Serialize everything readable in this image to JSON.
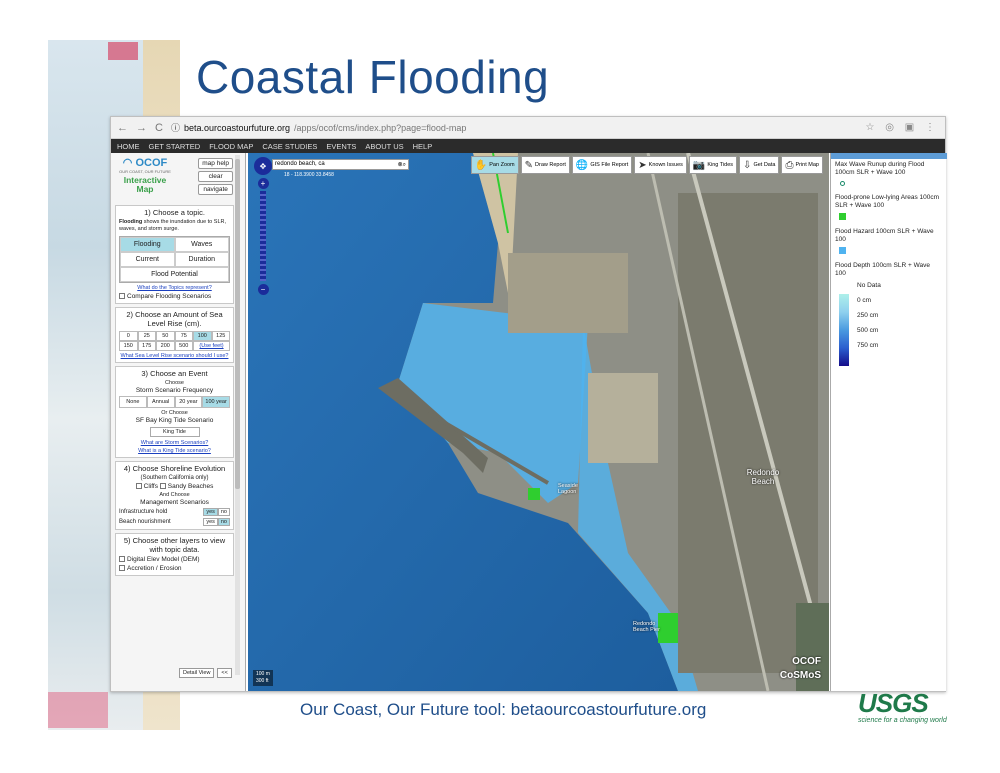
{
  "slide": {
    "title": "Coastal Flooding",
    "caption": "Our Coast, Our Future tool: betaourcoastourfuture.org",
    "usgs": {
      "mark": "USGS",
      "tagline": "science for a changing world"
    }
  },
  "browser": {
    "url_host": "beta.ourcoastourfuture.org",
    "url_path": "/apps/ocof/cms/index.php?page=flood-map"
  },
  "nav": [
    "HOME",
    "GET STARTED",
    "FLOOD MAP",
    "CASE STUDIES",
    "EVENTS",
    "ABOUT US",
    "HELP"
  ],
  "panel": {
    "logo_brand": "OCOF",
    "logo_sub": "OUR COAST, OUR FUTURE",
    "logo_title": "Interactive Map",
    "buttons": [
      "map help",
      "clear",
      "navigate"
    ],
    "sec1": {
      "title": "1) Choose a topic.",
      "desc_bold": "Flooding",
      "desc": " shows the inundation due to SLR, waves, and storm surge.",
      "topics": [
        "Flooding",
        "Waves",
        "Current",
        "Duration",
        "Flood Potential"
      ],
      "link": "What do the Topics represent?",
      "compare": "Compare Flooding Scenarios"
    },
    "sec2": {
      "title": "2) Choose an Amount of Sea Level Rise (cm).",
      "values": [
        "0",
        "25",
        "50",
        "75",
        "100",
        "125",
        "150",
        "175",
        "200",
        "500",
        "(Use feet)"
      ],
      "link": "What Sea Level Rise scenario should I use?"
    },
    "sec3": {
      "title": "3) Choose an Event",
      "choose": "Choose",
      "storm_label": "Storm Scenario Frequency",
      "storm": [
        "None",
        "Annual",
        "20 year",
        "100 year"
      ],
      "or_choose": "Or Choose",
      "king_label": "SF Bay King Tide Scenario",
      "king_btn": "King Tide",
      "link1": "What are Storm Scenarios?",
      "link2": "What is a King Tide scenario?"
    },
    "sec4": {
      "title": "4) Choose Shoreline Evolution",
      "sub": "(Southern California only)",
      "cliffs": "Cliffs",
      "beaches": "Sandy Beaches",
      "and_choose": "And Choose",
      "mgmt": "Management Scenarios",
      "infra": "Infrastructure hold",
      "nourish": "Beach nourishment",
      "yes": "yes",
      "no": "no"
    },
    "sec5": {
      "title": "5) Choose other layers to view with topic data.",
      "dem": "Digital Elev Model (DEM)",
      "accretion": "Accretion / Erosion"
    },
    "detail_view": "Detail View",
    "collapse": "<<"
  },
  "map": {
    "search_value": "redondo beach, ca",
    "coords": "18 - 118.3900 33.8458",
    "tools": [
      {
        "icon": "hand-icon",
        "glyph": "✋",
        "label": "Pan Zoom"
      },
      {
        "icon": "pencil-icon",
        "glyph": "✎",
        "label": "Draw Report"
      },
      {
        "icon": "globe-icon",
        "glyph": "🌐",
        "label": "GIS File Report"
      },
      {
        "icon": "cursor-icon",
        "glyph": "➤",
        "label": "Known Issues"
      },
      {
        "icon": "camera-icon",
        "glyph": "📷",
        "label": "King Tides"
      },
      {
        "icon": "download-icon",
        "glyph": "⇩",
        "label": "Get Data"
      },
      {
        "icon": "printer-icon",
        "glyph": "⎙",
        "label": "Print Map"
      }
    ],
    "scale_m": "100 m",
    "scale_ft": "300 ft",
    "labels": {
      "redondo_beach": "Redondo Beach",
      "seaside_lagoon": "Seaside Lagoon",
      "redondo_pier": "Redondo Beach Pier"
    },
    "watermark1": "OCOF",
    "watermark2": "CoSMoS"
  },
  "legend": {
    "item1": "Max Wave Runup during Flood 100cm SLR + Wave 100",
    "item2": "Flood-prone Low-lying Areas 100cm SLR + Wave 100",
    "item3": "Flood Hazard 100cm SLR + Wave 100",
    "item4": "Flood Depth 100cm SLR + Wave 100",
    "ramp": [
      "No Data",
      "0 cm",
      "250 cm",
      "500 cm",
      "750 cm"
    ],
    "colors": {
      "flood_prone": "#2fce2f",
      "flood_hazard": "#4fb3f0",
      "accent": "#a7dbe6"
    }
  }
}
